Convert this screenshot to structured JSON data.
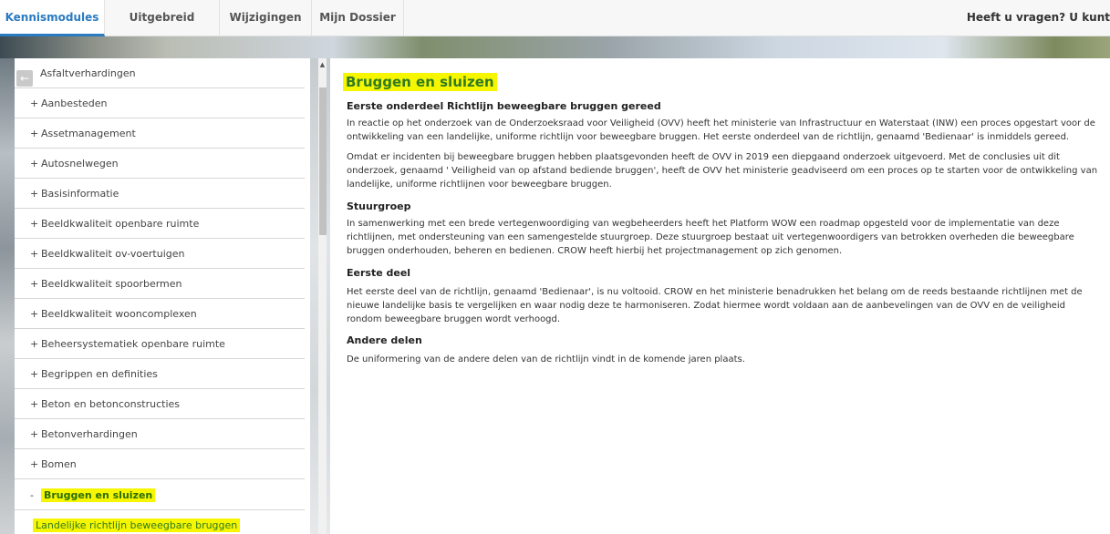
{
  "nav": {
    "tabs": [
      "Kennismodules",
      "Uitgebreid Zoeken",
      "Wijzigingen",
      "Mijn Dossier"
    ],
    "active_tab": "Kennismodules",
    "help_text": "Heeft u vragen? U kunt"
  },
  "sidebar": {
    "items": [
      {
        "prefix": "",
        "label": "Asfaltverhardingen"
      },
      {
        "prefix": "+",
        "label": "Aanbesteden"
      },
      {
        "prefix": "+",
        "label": "Assetmanagement"
      },
      {
        "prefix": "+",
        "label": "Autosnelwegen"
      },
      {
        "prefix": "+",
        "label": "Basisinformatie"
      },
      {
        "prefix": "+",
        "label": "Beeldkwaliteit openbare ruimte"
      },
      {
        "prefix": "+",
        "label": "Beeldkwaliteit ov-voertuigen"
      },
      {
        "prefix": "+",
        "label": "Beeldkwaliteit spoorbermen"
      },
      {
        "prefix": "+",
        "label": "Beeldkwaliteit wooncomplexen"
      },
      {
        "prefix": "+",
        "label": "Beheersystematiek openbare ruimte"
      },
      {
        "prefix": "+",
        "label": "Begrippen en definities"
      },
      {
        "prefix": "+",
        "label": "Beton en betonconstructies"
      },
      {
        "prefix": "+",
        "label": "Betonverhardingen"
      },
      {
        "prefix": "+",
        "label": "Bomen"
      },
      {
        "prefix": "-",
        "label": "Bruggen en sluizen"
      }
    ],
    "sub_item": "Landelijke richtlijn beweegbare bruggen",
    "back_icon": "arrow-left-icon"
  },
  "content": {
    "title": "Bruggen en sluizen",
    "h1": "Eerste onderdeel Richtlijn beweegbare bruggen gereed",
    "p1": "In reactie op het onderzoek van de Onderzoeksraad voor Veiligheid (OVV) heeft het ministerie van Infrastructuur en Waterstaat (INW) een proces opgestart voor de ontwikkeling van een landelijke, uniforme richtlijn voor beweegbare bruggen. Het eerste onderdeel van de richtlijn, genaamd 'Bedienaar' is inmiddels gereed.",
    "p2": "Omdat er incidenten bij beweegbare bruggen hebben plaatsgevonden heeft de OVV in 2019 een diepgaand onderzoek uitgevoerd. Met de conclusies uit dit onderzoek, genaamd ' Veiligheid van op afstand bediende bruggen', heeft de OVV het ministerie geadviseerd om een proces op te starten voor de ontwikkeling van landelijke, uniforme richtlijnen voor beweegbare bruggen.",
    "h2": "Stuurgroep",
    "p3": "In samenwerking met een brede vertegenwoordiging van wegbeheerders heeft het Platform WOW een roadmap opgesteld voor de implementatie van deze richtlijnen, met ondersteuning van een samengestelde stuurgroep. Deze stuurgroep bestaat uit vertegenwoordigers van betrokken overheden die beweegbare bruggen onderhouden, beheren en bedienen. CROW heeft hierbij het projectmanagement op zich genomen.",
    "h3": "Eerste deel",
    "p4": "Het eerste deel van de richtlijn, genaamd 'Bedienaar', is nu voltooid. CROW en het ministerie benadrukken het belang om de reeds bestaande richtlijnen met de nieuwe landelijke basis te vergelijken en waar nodig deze te harmoniseren. Zodat hiermee wordt voldaan aan de aanbevelingen van de OVV en de veiligheid rondom beweegbare bruggen wordt verhoogd.",
    "h4": "Andere delen",
    "p5": "De uniformering van de andere delen van de richtlijn vindt in de komende jaren plaats."
  },
  "colors": {
    "accent": "#2a7bc0",
    "highlight": "#f6f600",
    "highlight_text": "#2f7a22"
  }
}
